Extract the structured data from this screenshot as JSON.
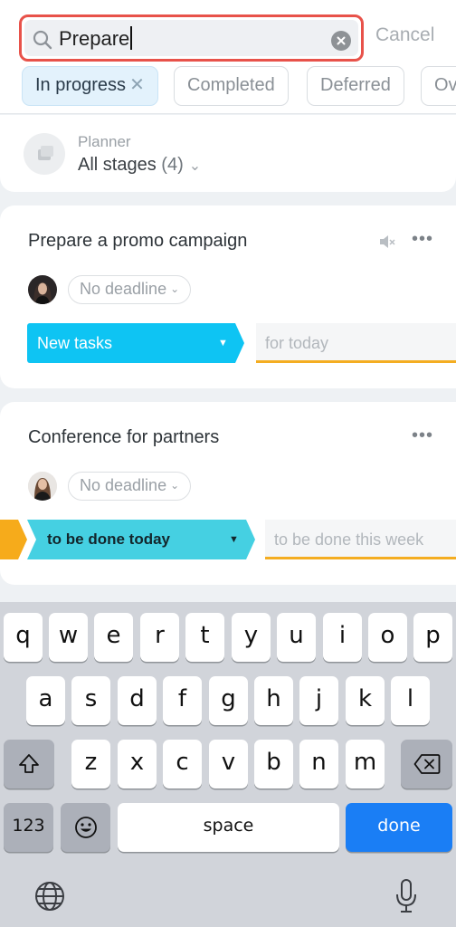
{
  "search": {
    "query": "Prepare",
    "cancel_label": "Cancel"
  },
  "filters": [
    {
      "label": "In progress",
      "active": true
    },
    {
      "label": "Completed",
      "active": false
    },
    {
      "label": "Deferred",
      "active": false
    },
    {
      "label": "Ov",
      "active": false
    }
  ],
  "planner": {
    "label": "Planner",
    "value": "All stages",
    "count": "(4)"
  },
  "tasks": [
    {
      "title": "Prepare a promo campaign",
      "deadline": "No deadline",
      "stage": "New tasks",
      "stage_color": "#0ec4f3",
      "next_stage": "for today",
      "muted": true
    },
    {
      "title": "Conference for partners",
      "deadline": "No deadline",
      "stage": "to be done today",
      "stage_color": "#45d0e2",
      "next_stage": "to be done this week",
      "prev_stage_color": "#f6ab1b"
    }
  ],
  "keyboard": {
    "row1": [
      "q",
      "w",
      "e",
      "r",
      "t",
      "y",
      "u",
      "i",
      "o",
      "p"
    ],
    "row2": [
      "a",
      "s",
      "d",
      "f",
      "g",
      "h",
      "j",
      "k",
      "l"
    ],
    "row3": [
      "z",
      "x",
      "c",
      "v",
      "b",
      "n",
      "m"
    ],
    "numbers_label": "123",
    "space_label": "space",
    "done_label": "done"
  }
}
